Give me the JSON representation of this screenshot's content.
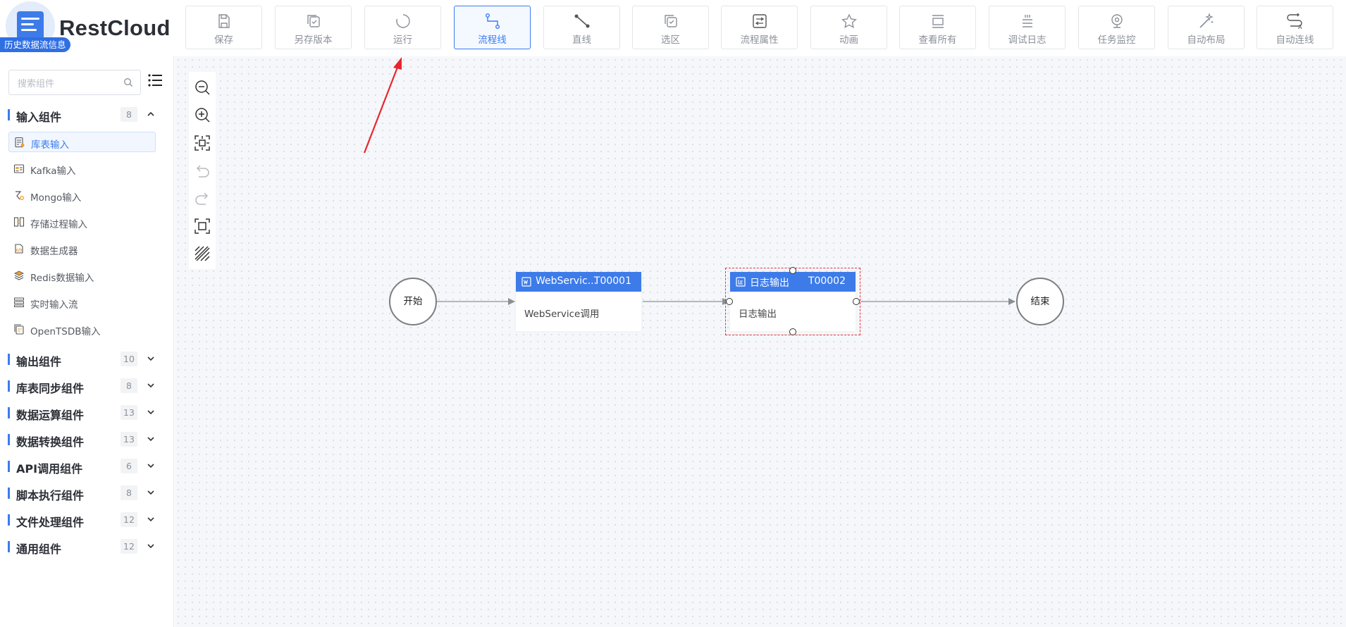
{
  "brand": {
    "name": "RestCloud",
    "history_badge": "历史数据流信息"
  },
  "toolbar": [
    {
      "label": "保存",
      "icon": "save-icon"
    },
    {
      "label": "另存版本",
      "icon": "save-version-icon"
    },
    {
      "label": "运行",
      "icon": "run-icon"
    },
    {
      "label": "流程线",
      "icon": "flow-line-icon",
      "active": true
    },
    {
      "label": "直线",
      "icon": "straight-line-icon"
    },
    {
      "label": "选区",
      "icon": "selection-icon"
    },
    {
      "label": "流程属性",
      "icon": "process-properties-icon"
    },
    {
      "label": "动画",
      "icon": "animation-icon"
    },
    {
      "label": "查看所有",
      "icon": "view-all-icon"
    },
    {
      "label": "调试日志",
      "icon": "debug-log-icon"
    },
    {
      "label": "任务监控",
      "icon": "task-monitor-icon"
    },
    {
      "label": "自动布局",
      "icon": "auto-layout-icon"
    },
    {
      "label": "自动连线",
      "icon": "auto-connect-icon"
    }
  ],
  "sidebar": {
    "search_placeholder": "搜索组件",
    "categories": [
      {
        "title": "输入组件",
        "count": "8",
        "expanded": true
      },
      {
        "title": "输出组件",
        "count": "10"
      },
      {
        "title": "库表同步组件",
        "count": "8"
      },
      {
        "title": "数据运算组件",
        "count": "13"
      },
      {
        "title": "数据转换组件",
        "count": "13"
      },
      {
        "title": "API调用组件",
        "count": "6"
      },
      {
        "title": "脚本执行组件",
        "count": "8"
      },
      {
        "title": "文件处理组件",
        "count": "12"
      },
      {
        "title": "通用组件",
        "count": "12"
      }
    ],
    "input_items": [
      {
        "label": "库表输入",
        "icon": "table-input-icon",
        "selected": true
      },
      {
        "label": "Kafka输入",
        "icon": "kafka-icon"
      },
      {
        "label": "Mongo输入",
        "icon": "mongo-icon"
      },
      {
        "label": "存储过程输入",
        "icon": "stored-procedure-icon"
      },
      {
        "label": "数据生成器",
        "icon": "data-generator-icon"
      },
      {
        "label": "Redis数据输入",
        "icon": "redis-icon"
      },
      {
        "label": "实时输入流",
        "icon": "realtime-stream-icon"
      },
      {
        "label": "OpenTSDB输入",
        "icon": "opentsdb-icon"
      }
    ]
  },
  "canvas": {
    "zoom_tools": [
      "zoom-out-icon",
      "zoom-in-icon",
      "fit-view-icon",
      "undo-icon",
      "redo-icon",
      "actual-size-icon",
      "grid-toggle-icon"
    ],
    "nodes": {
      "start": {
        "label": "开始"
      },
      "webservice": {
        "name": "WebServic...",
        "id": "T00001",
        "body": "WebService调用",
        "icon": "webservice-icon"
      },
      "log_output": {
        "name": "日志输出",
        "id": "T00002",
        "body": "日志输出",
        "icon": "log-output-icon"
      },
      "end": {
        "label": "结束"
      }
    }
  },
  "colors": {
    "accent": "#3d7be9",
    "selection": "#e8303a",
    "annotation_arrow": "#e8262b"
  }
}
